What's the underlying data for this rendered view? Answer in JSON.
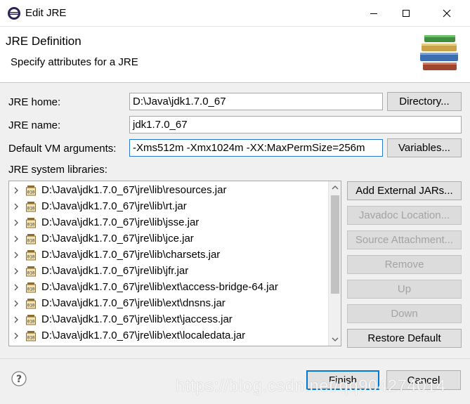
{
  "window": {
    "title": "Edit JRE"
  },
  "banner": {
    "title": "JRE Definition",
    "description": "Specify attributes for a JRE"
  },
  "form": {
    "jre_home_label": "JRE home:",
    "jre_home_value": "D:\\Java\\jdk1.7.0_67",
    "directory_button": "Directory...",
    "jre_name_label": "JRE name:",
    "jre_name_value": "jdk1.7.0_67",
    "vm_args_label": "Default VM arguments:",
    "vm_args_value": "-Xms512m -Xmx1024m -XX:MaxPermSize=256m",
    "variables_button": "Variables...",
    "libraries_label": "JRE system libraries:"
  },
  "libraries": [
    "D:\\Java\\jdk1.7.0_67\\jre\\lib\\resources.jar",
    "D:\\Java\\jdk1.7.0_67\\jre\\lib\\rt.jar",
    "D:\\Java\\jdk1.7.0_67\\jre\\lib\\jsse.jar",
    "D:\\Java\\jdk1.7.0_67\\jre\\lib\\jce.jar",
    "D:\\Java\\jdk1.7.0_67\\jre\\lib\\charsets.jar",
    "D:\\Java\\jdk1.7.0_67\\jre\\lib\\jfr.jar",
    "D:\\Java\\jdk1.7.0_67\\jre\\lib\\ext\\access-bridge-64.jar",
    "D:\\Java\\jdk1.7.0_67\\jre\\lib\\ext\\dnsns.jar",
    "D:\\Java\\jdk1.7.0_67\\jre\\lib\\ext\\jaccess.jar",
    "D:\\Java\\jdk1.7.0_67\\jre\\lib\\ext\\localedata.jar"
  ],
  "side_buttons": {
    "add_external": "Add External JARs...",
    "javadoc": "Javadoc Location...",
    "source": "Source Attachment...",
    "remove": "Remove",
    "up": "Up",
    "down": "Down",
    "restore": "Restore Default"
  },
  "footer": {
    "finish": "Finish",
    "cancel": "Cancel"
  },
  "watermark": "https://blog.csdn.net/qq904274014",
  "icons": {
    "app": "eclipse-icon",
    "banner": "books-icon",
    "jar": "jar-file-icon",
    "help": "help-icon"
  },
  "colors": {
    "focus": "#2a77d2",
    "default_button": "#0078d7"
  }
}
